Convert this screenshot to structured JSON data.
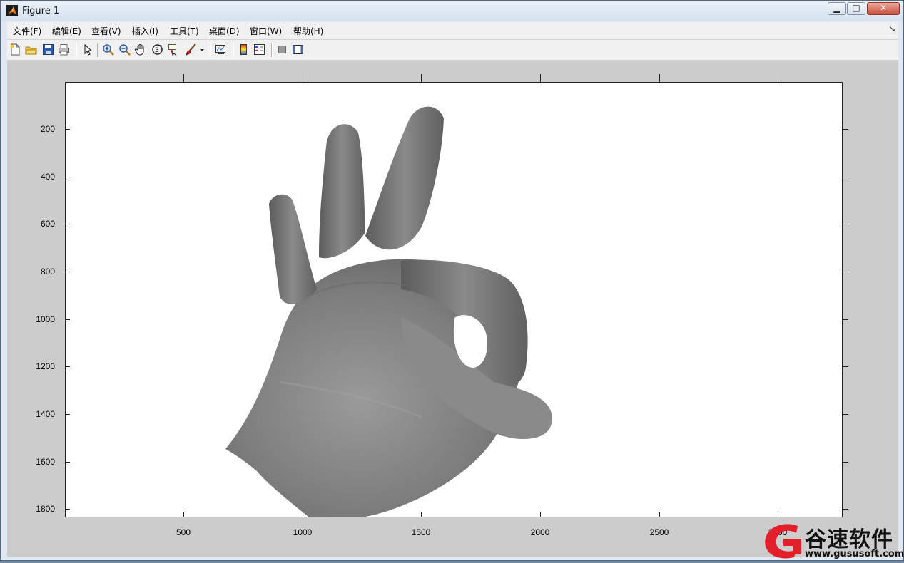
{
  "window": {
    "title": "Figure 1",
    "controls": {
      "minimize": "▁",
      "maximize": "□",
      "close": "✕"
    }
  },
  "menubar": {
    "items": [
      "文件(F)",
      "编辑(E)",
      "查看(V)",
      "插入(I)",
      "工具(T)",
      "桌面(D)",
      "窗口(W)",
      "帮助(H)"
    ],
    "overflow_arrow": "↘"
  },
  "toolbar": {
    "icons": [
      "new-figure-icon",
      "open-file-icon",
      "save-icon",
      "print-icon",
      "edit-plot-arrow-icon",
      "zoom-in-icon",
      "zoom-out-icon",
      "pan-hand-icon",
      "rotate-3d-icon",
      "data-cursor-icon",
      "brush-icon",
      "brush-dropdown-icon",
      "link-plot-icon",
      "colorbar-icon",
      "legend-icon",
      "hide-plot-tools-icon",
      "show-plot-tools-icon"
    ]
  },
  "axes": {
    "yticks": [
      "200",
      "400",
      "600",
      "800",
      "1000",
      "1200",
      "1400",
      "1600",
      "1800"
    ],
    "xticks": [
      "500",
      "1000",
      "1500",
      "2000",
      "2500",
      "3000"
    ]
  },
  "image": {
    "content": "grayscale-hand-ok-gesture"
  },
  "watermark": {
    "text": "谷速软件",
    "url": "www.gususoft.com",
    "color": "#e3202a"
  }
}
